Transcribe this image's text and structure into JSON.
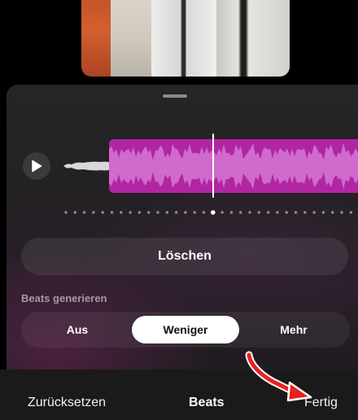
{
  "editor": {
    "delete_label": "Löschen",
    "section_label": "Beats generieren",
    "options": [
      "Aus",
      "Weniger",
      "Mehr"
    ],
    "selected_option": "Weniger"
  },
  "bottom_bar": {
    "reset_label": "Zurücksetzen",
    "title": "Beats",
    "done_label": "Fertig"
  },
  "icons": {
    "play": "play-icon",
    "annotation": "red-arrow-icon"
  },
  "colors": {
    "waveform": "#b026a2",
    "waveform_light": "#d06acb",
    "selected_segment": "#ffffff",
    "annotation_arrow": "#e8211f"
  }
}
